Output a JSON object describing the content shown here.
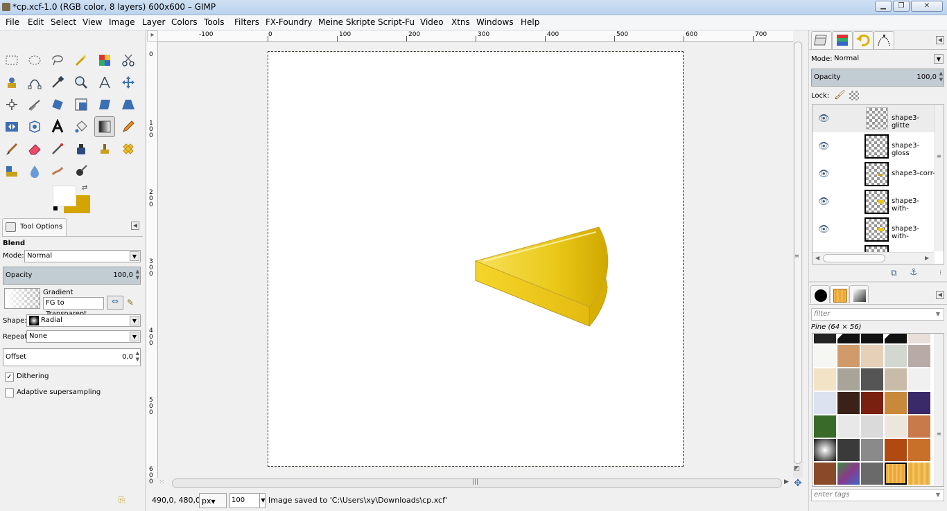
{
  "window": {
    "title": "*cp.xcf-1.0 (RGB color, 8 layers) 600x600 – GIMP",
    "min_btn": "▁",
    "max_btn": "❐",
    "close_btn": "✕"
  },
  "menubar": [
    "File",
    "Edit",
    "Select",
    "View",
    "Image",
    "Layer",
    "Colors",
    "Tools",
    "Filters",
    "FX-Foundry",
    "Meine Skripte",
    "Script-Fu",
    "Video",
    "Xtns",
    "Windows",
    "Help"
  ],
  "ruler": {
    "h_ticks": [
      "-100",
      "0",
      "100",
      "200",
      "300",
      "400",
      "500",
      "600",
      "700"
    ],
    "v_ticks": [
      "0",
      "100",
      "200",
      "300",
      "400",
      "500",
      "600"
    ]
  },
  "tool_options": {
    "tab_label": "Tool Options",
    "tool_name": "Blend",
    "mode_label": "Mode:",
    "mode_value": "Normal",
    "opacity_label": "Opacity",
    "opacity_value": "100,0",
    "gradient_label": "Gradient",
    "gradient_value": "FG to Transparent",
    "shape_label": "Shape:",
    "shape_value": "Radial",
    "repeat_label": "Repeat:",
    "repeat_value": "None",
    "offset_label": "Offset",
    "offset_value": "0,0",
    "dithering_label": "Dithering",
    "dithering_checked": true,
    "adaptive_label": "Adaptive supersampling",
    "adaptive_checked": false
  },
  "status": {
    "coords": "490,0, 480,0",
    "unit": "px",
    "zoom": "100",
    "message": "Image saved to 'C:\\Users\\xy\\Downloads\\cp.xcf'"
  },
  "layers_panel": {
    "mode_label": "Mode:",
    "mode_value": "Normal",
    "opacity_label": "Opacity",
    "opacity_value": "100,0",
    "lock_label": "Lock:",
    "layers": [
      "shape3-glitte",
      "shape3-gloss",
      "shape3-corr-",
      "shape3-with-",
      "shape3-with-"
    ]
  },
  "patterns_panel": {
    "filter_placeholder": "filter",
    "selected_name": "Pine (64 × 56)",
    "tags_placeholder": "enter tags"
  },
  "colors": {
    "fg": "#000000",
    "bg": "#d4a400",
    "accent": "#c8a400",
    "shape_yellow": "#f0cc10"
  }
}
